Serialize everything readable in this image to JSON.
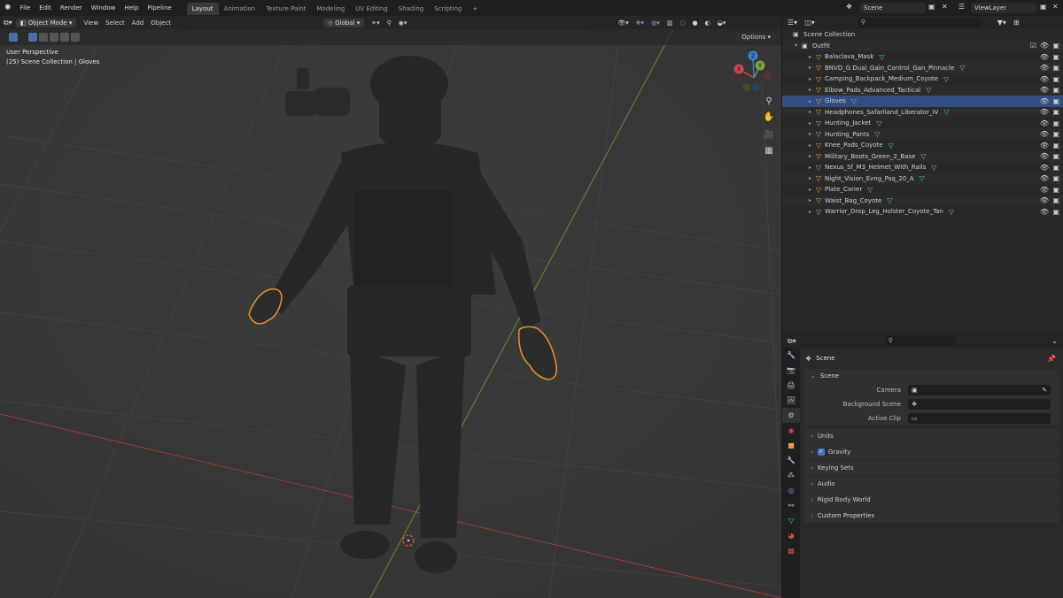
{
  "menu": [
    "File",
    "Edit",
    "Render",
    "Window",
    "Help",
    "Pipeline"
  ],
  "workspaces": [
    "Layout",
    "Animation",
    "Texture Paint",
    "Modeling",
    "UV Editing",
    "Shading",
    "Scripting",
    "+"
  ],
  "active_workspace": "Layout",
  "scene_name": "Scene",
  "view_layer": "ViewLayer",
  "viewport_header": {
    "mode": "Object Mode",
    "items": [
      "View",
      "Select",
      "Add",
      "Object"
    ],
    "transform": "Global",
    "options": "Options"
  },
  "viewport_info": {
    "line1": "User Perspective",
    "line2": "(25) Scene Collection | Gloves"
  },
  "gizmo": {
    "x": "X",
    "y": "Y",
    "z": "Z"
  },
  "outliner": {
    "root": "Scene Collection",
    "collection": "Outfit",
    "items": [
      "Balaclava_Mask",
      "BNVD_G Dual_Gain_Control_Gan_Pinnacle",
      "Camping_Backpack_Medium_Coyote",
      "Elbow_Pads_Advanced_Tactical",
      "Gloves",
      "Headphones_Safariland_Liberator_IV",
      "Hunting_Jacket",
      "Hunting_Pants",
      "Knee_Pads_Coyote",
      "Military_Boots_Green_2_Base",
      "Nexus_Sf_M3_Helmet_With_Rails",
      "Night_Vision_Evng_Psq_20_A",
      "Plate_Carier",
      "Waist_Bag_Coyote",
      "Warrior_Drop_Leg_Holster_Coyote_Tan"
    ],
    "selected": "Gloves"
  },
  "properties": {
    "context": "Scene",
    "panel": "Scene",
    "rows": [
      {
        "label": "Camera",
        "value": ""
      },
      {
        "label": "Background Scene",
        "value": ""
      },
      {
        "label": "Active Clip",
        "value": ""
      }
    ],
    "subpanels": [
      "Units",
      "Gravity",
      "Keying Sets",
      "Audio",
      "Rigid Body World",
      "Custom Properties"
    ],
    "gravity_checked": true
  },
  "colors": {
    "selection_outline": "#e8912d",
    "selected_row": "#334d80",
    "grid_x_axis": "#9e3b3b",
    "grid_y_axis": "#6b8a2e",
    "mesh_icon": "#e7a04a",
    "data_icon": "#4ec9a4"
  }
}
